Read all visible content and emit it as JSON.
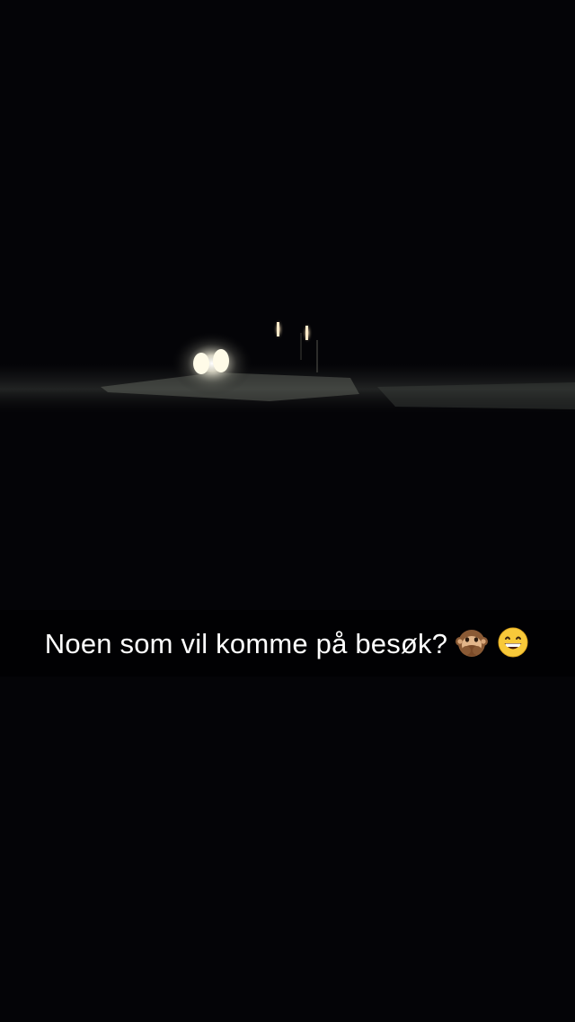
{
  "snap": {
    "caption": "Noen som vil komme på besøk?",
    "emojis": [
      {
        "name": "see-no-evil-monkey-icon",
        "glyph": "🙊"
      },
      {
        "name": "grinning-face-icon",
        "glyph": "😄"
      }
    ]
  },
  "colors": {
    "background": "#050508",
    "caption_bar": "#000000",
    "caption_text": "#ffffff",
    "headlight": "#fffbe8"
  }
}
